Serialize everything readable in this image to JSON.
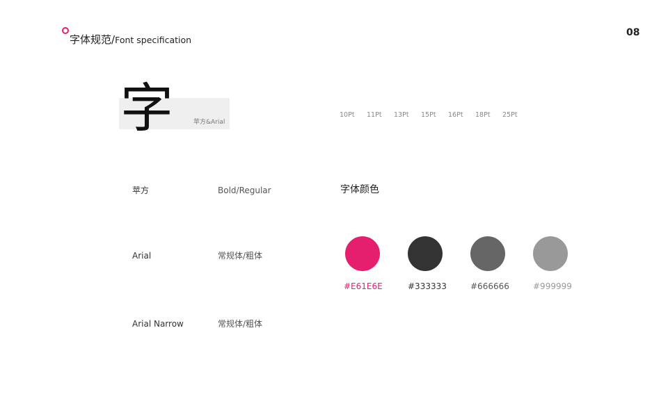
{
  "header": {
    "title_cn": "字体规范",
    "title_sep": "/",
    "title_en": "Font specification",
    "page_number": "08",
    "accent_color": "#E61E6E"
  },
  "specimen": {
    "char": "字",
    "caption": "苹方&Arial"
  },
  "sizes": [
    "10Pt",
    "11Pt",
    "13Pt",
    "15Pt",
    "16Pt",
    "18Pt",
    "25Pt"
  ],
  "fonts": [
    {
      "name": "苹方",
      "weights": "Bold/Regular"
    },
    {
      "name": "Arial",
      "weights": "常规体/粗体"
    },
    {
      "name": "Arial Narrow",
      "weights": "常规体/粗体"
    }
  ],
  "colors": {
    "title": "字体颜色",
    "swatches": [
      {
        "hex": "#E61E6E",
        "label": "#E61E6E",
        "label_color": "#E61E6E"
      },
      {
        "hex": "#333333",
        "label": "#333333",
        "label_color": "#333333"
      },
      {
        "hex": "#666666",
        "label": "#666666",
        "label_color": "#555555"
      },
      {
        "hex": "#999999",
        "label": "#999999",
        "label_color": "#999999"
      }
    ]
  }
}
